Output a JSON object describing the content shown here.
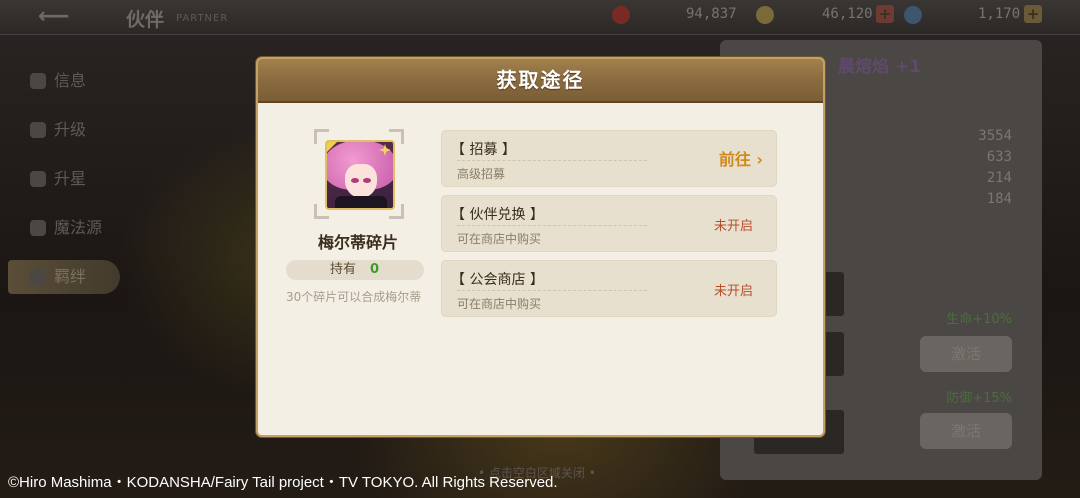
{
  "header": {
    "title": "伙伴",
    "subtitle": "PARTNER",
    "resources": [
      {
        "value": "94,837",
        "icon": "gold-coin-icon"
      },
      {
        "value": "46,120",
        "icon": "blue-gem-icon"
      },
      {
        "value": "1,170",
        "icon": "plus-icon"
      }
    ]
  },
  "sidebar": {
    "items": [
      {
        "label": "信息"
      },
      {
        "label": "升级"
      },
      {
        "label": "升星"
      },
      {
        "label": "魔法源"
      },
      {
        "label": "羁绊"
      }
    ]
  },
  "right_panel": {
    "title": "晨熔焰 +1",
    "stats": [
      "3554",
      "633",
      "214",
      "184"
    ],
    "bonuses": [
      "生命+10%",
      "防御+15%"
    ],
    "buttons": [
      "激活",
      "激活"
    ]
  },
  "modal": {
    "title": "获取途径",
    "item": {
      "name": "梅尔蒂碎片",
      "own_label": "持有",
      "own_count": "0",
      "description": "30个碎片可以合成梅尔蒂"
    },
    "sources": [
      {
        "title": "【 招募 】",
        "sub": "高级招募",
        "action": "前往 ›"
      },
      {
        "title": "【 伙伴兑换 】",
        "sub": "可在商店中购买",
        "status": "未开启"
      },
      {
        "title": "【 公会商店 】",
        "sub": "可在商店中购买",
        "status": "未开启"
      }
    ]
  },
  "hint": "• 点击空白区域关闭 •",
  "copyright": "©Hiro Mashima・KODANSHA/Fairy Tail project・TV TOKYO. All Rights Reserved.",
  "colors": {
    "modal_header": "#8a6b3f",
    "modal_body": "#f4efe4",
    "go_action": "#d08a1b",
    "locked_status": "#b5502b",
    "own_count": "#3e9a2a"
  }
}
